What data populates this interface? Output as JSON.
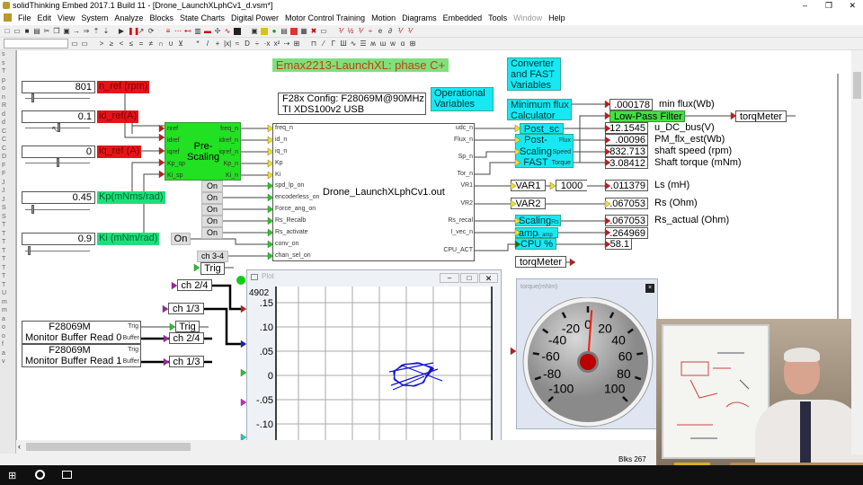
{
  "window": {
    "title": "solidThinking Embed 2017.1 Build 11 - [Drone_LaunchXLphCv1_d.vsm*]"
  },
  "menu": [
    "File",
    "Edit",
    "View",
    "System",
    "Analyze",
    "Blocks",
    "State Charts",
    "Digital Power",
    "Motor Control Training",
    "Motion",
    "Diagrams",
    "Embedded",
    "Tools",
    "Window",
    "Help"
  ],
  "diagram": {
    "title": "Emax2213-LaunchXL: phase C+",
    "config": [
      "F28x Config: F28069M@90MHz",
      "TI XDS100v2 USB"
    ],
    "operational_variables": "Operational Variables",
    "converter_label": "Converter and FAST Variables",
    "min_flux_label": "Minimum flux Calculator",
    "sliders": [
      {
        "value": "801",
        "label": "n_ref (rpm)",
        "color": "#e4141a",
        "position": 0.1
      },
      {
        "value": "0.1",
        "label": "id_ref(A)",
        "color": "#e4141a",
        "position": 0.55
      },
      {
        "value": "0",
        "label": "iq_ref (A)",
        "color": "#e4141a",
        "position": 0.5
      },
      {
        "value": "0.45",
        "label": "Kp(mNms/rad)",
        "color": "#1de07a",
        "position": 0.1
      },
      {
        "value": "0.9",
        "label": "Ki (mNm/rad)",
        "color": "#1de07a",
        "position": 0.05
      }
    ],
    "prescaling": {
      "label": "Pre-Scaling",
      "inputs": [
        "nref",
        "idref",
        "iqref",
        "Kp_sp",
        "Ki_sp"
      ],
      "outputs": [
        "freq_n",
        "idref_n",
        "iqref_n",
        "Kp_n",
        "Ki_n"
      ]
    },
    "on_buttons": [
      "On",
      "On",
      "On",
      "On",
      "On"
    ],
    "conv_on_button": "On",
    "ch34": "ch 3-4",
    "trig": "Trig",
    "main_block": {
      "label": "Drone_LaunchXLphCv1.out",
      "inputs": [
        "freq_n",
        "id_n",
        "iq_n",
        "Kp",
        "Ki",
        "spd_lp_on",
        "encoderless_on",
        "Force_ang_on",
        "Rs_Recalb",
        "Rs_activate",
        "conv_on",
        "chan_sel_on"
      ],
      "outputs": [
        "udc_n",
        "Flux_n",
        "Sp_n",
        "Tor_n",
        "VR1",
        "VR2",
        "Rs_recal",
        "I_vec_n",
        "CPU_ACT"
      ]
    },
    "post_sc": "Post_sc",
    "post_scaling": {
      "label": "Post- Scaling FAST",
      "ports": [
        "Flux",
        "Speed",
        "Torque"
      ]
    },
    "lowpass": "Low-Pass Filter",
    "torqmeter": "torqMeter",
    "displays": [
      {
        "value": ".000178",
        "label": "min flux(Wb)"
      },
      {
        "value": "12.1545",
        "label": "u_DC_bus(V)"
      },
      {
        "value": ".00096",
        "label": "PM_flx_est(Wb)"
      },
      {
        "value": "832.713",
        "label": "shaft speed (rpm)"
      },
      {
        "value": "3.08412",
        "label": "Shaft torque (mNm)"
      },
      {
        "value": ".011379",
        "label": "Ls (mH)"
      },
      {
        "value": ".067053",
        "label": "Rs (Ohm)"
      },
      {
        "value": ".067053",
        "label": "Rs_actual (Ohm)"
      },
      {
        "value": ".264969",
        "label": ""
      },
      {
        "value": "58.1",
        "label": ""
      }
    ],
    "var1": "VAR1",
    "var2": "VAR2",
    "gain": "1000",
    "scaling": {
      "label": "Scaling",
      "port": "Rs"
    },
    "amp": {
      "label": "amp",
      "port": "i_amp"
    },
    "cpu": "CPU %",
    "monitor": [
      {
        "line1": "F28069M",
        "line2": "Monitor Buffer Read 0",
        "trig": "Trig",
        "buffer": "Buffer"
      },
      {
        "line1": "F28069M",
        "line2": "Monitor Buffer Read 1",
        "trig": "Trig",
        "buffer": "Buffer"
      }
    ],
    "channels": {
      "ch24": "ch 2/4",
      "ch13": "ch 1/3"
    }
  },
  "plot": {
    "title": "Plot",
    "corner": "4902",
    "yticks": [
      ".15",
      ".10",
      ".05",
      "0",
      "-.05",
      "-.10"
    ],
    "trace_color": "#1414d0"
  },
  "gauge": {
    "title": "torque(mNm)",
    "ticks": [
      "-100",
      "-80",
      "-60",
      "-40",
      "-20",
      "0",
      "20",
      "40",
      "60",
      "80",
      "100"
    ],
    "value": 3.08412,
    "min": -100,
    "max": 100
  },
  "status": {
    "blocks": "Blks  267"
  }
}
